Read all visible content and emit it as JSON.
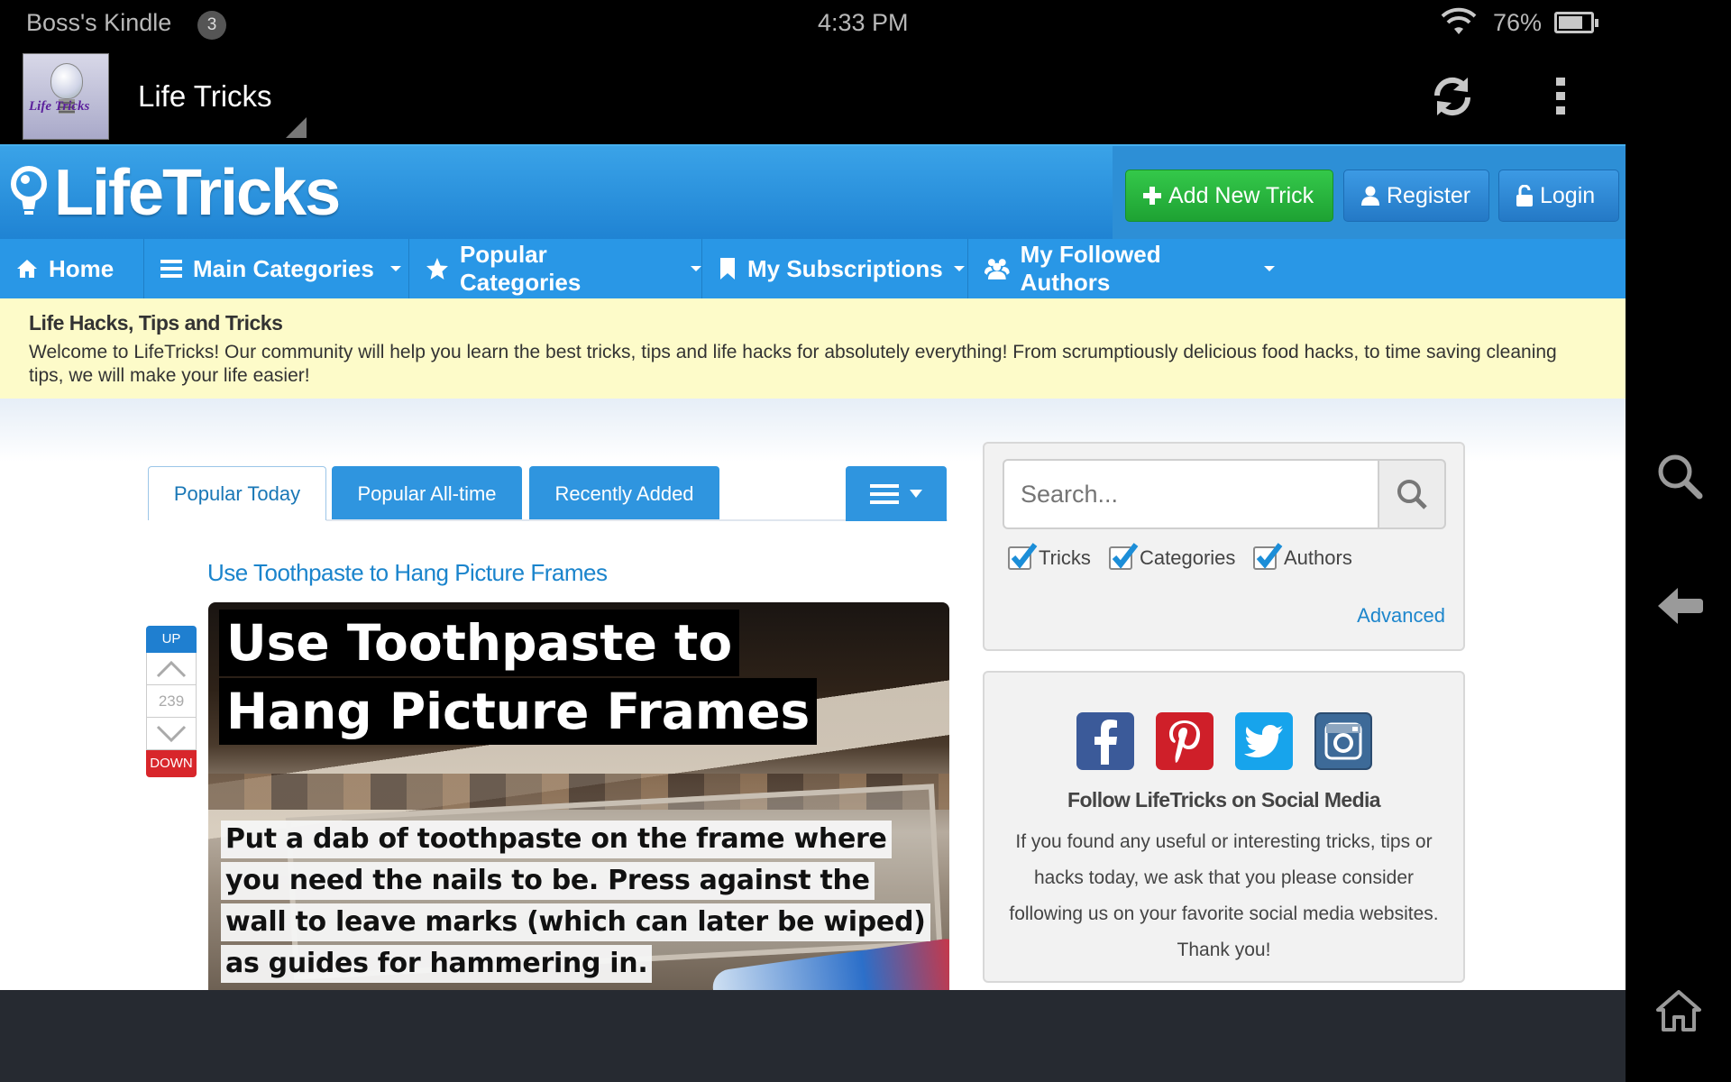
{
  "status_bar": {
    "device_name": "Boss's Kindle",
    "notification_count": "3",
    "time": "4:33 PM",
    "battery_percent": "76%",
    "battery_level": 0.76
  },
  "app_bar": {
    "icon_label": "Life Tricks",
    "title": "Life Tricks"
  },
  "site": {
    "logo_text": "LifeTricks",
    "buttons": {
      "add_new_trick": "Add New Trick",
      "register": "Register",
      "login": "Login"
    },
    "nav": [
      {
        "label": "Home",
        "icon": "home-icon"
      },
      {
        "label": "Main Categories",
        "icon": "list-icon"
      },
      {
        "label": "Popular Categories",
        "icon": "star-icon"
      },
      {
        "label": "My Subscriptions",
        "icon": "bookmark-icon"
      },
      {
        "label": "My Followed Authors",
        "icon": "users-icon"
      }
    ],
    "banner": {
      "title": "Life Hacks, Tips and Tricks",
      "text": "Welcome to LifeTricks! Our community will help you learn the best tricks, tips and life hacks for absolutely everything! From scrumptiously delicious food hacks, to time saving cleaning tips, we will make your life easier!"
    }
  },
  "tabs": [
    {
      "label": "Popular Today",
      "active": true
    },
    {
      "label": "Popular All-time",
      "active": false
    },
    {
      "label": "Recently Added",
      "active": false
    }
  ],
  "trick": {
    "title": "Use Toothpaste to Hang Picture Frames",
    "image_headline": [
      "Use Toothpaste to",
      "Hang Picture Frames"
    ],
    "image_caption": [
      "Put a dab of toothpaste on the frame where",
      "you need the nails to be. Press against the",
      "wall to leave marks (which can later be wiped)",
      "as guides for hammering in."
    ],
    "vote": {
      "up_label": "UP",
      "count": "239",
      "down_label": "DOWN"
    }
  },
  "search": {
    "placeholder": "Search...",
    "filters": [
      {
        "label": "Tricks",
        "checked": true
      },
      {
        "label": "Categories",
        "checked": true
      },
      {
        "label": "Authors",
        "checked": true
      }
    ],
    "advanced_label": "Advanced"
  },
  "social": {
    "networks": [
      "facebook-icon",
      "pinterest-icon",
      "twitter-icon",
      "instagram-icon"
    ],
    "title": "Follow LifeTricks on Social Media",
    "text": "If you found any useful or interesting tricks, tips or hacks today, we ask that you please consider following us on your favorite social media websites. Thank you!"
  },
  "colors": {
    "header_blue": "#2997e6",
    "add_button_green": "#23ad38",
    "banner_yellow": "#fdfbc9",
    "link_blue": "#1a84cc",
    "down_red": "#d8262b"
  }
}
